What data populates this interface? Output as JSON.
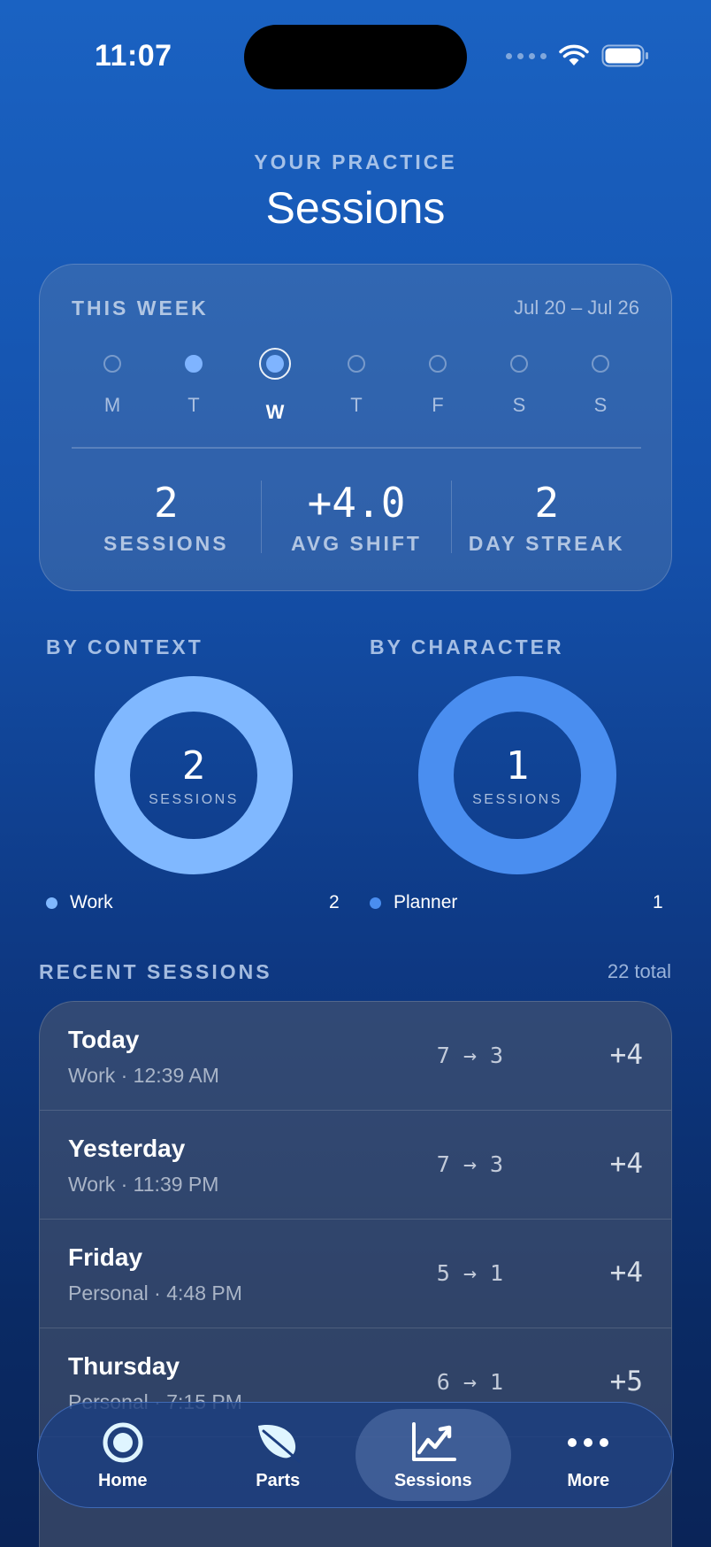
{
  "status_bar": {
    "time": "11:07"
  },
  "header": {
    "eyebrow": "YOUR PRACTICE",
    "title": "Sessions"
  },
  "week": {
    "label": "THIS WEEK",
    "range": "Jul 20 – Jul 26",
    "days": [
      "M",
      "T",
      "W",
      "T",
      "F",
      "S",
      "S"
    ],
    "stats": [
      {
        "value": "2",
        "label": "SESSIONS"
      },
      {
        "value": "+4.0",
        "label": "AVG SHIFT"
      },
      {
        "value": "2",
        "label": "DAY STREAK"
      }
    ]
  },
  "by_context": {
    "label": "BY CONTEXT",
    "value": "2",
    "unit": "SESSIONS",
    "color": "#80b8ff",
    "legend": {
      "name": "Work",
      "count": "2"
    }
  },
  "by_character": {
    "label": "BY CHARACTER",
    "value": "1",
    "unit": "SESSIONS",
    "color": "#4a8ef0",
    "legend": {
      "name": "Planner",
      "count": "1"
    }
  },
  "recent": {
    "label": "RECENT SESSIONS",
    "total": "22 total",
    "rows": [
      {
        "title": "Today",
        "sub": "Work · 12:39 AM",
        "shift": "7 → 3",
        "delta": "+4"
      },
      {
        "title": "Yesterday",
        "sub": "Work · 11:39 PM",
        "shift": "7 → 3",
        "delta": "+4"
      },
      {
        "title": "Friday",
        "sub": "Personal · 4:48 PM",
        "shift": "5 → 1",
        "delta": "+4"
      },
      {
        "title": "Thursday",
        "sub": "Personal · 7:15 PM",
        "shift": "6 → 1",
        "delta": "+5"
      }
    ]
  },
  "tabs": [
    {
      "label": "Home",
      "icon": "target-icon"
    },
    {
      "label": "Parts",
      "icon": "leaf-icon"
    },
    {
      "label": "Sessions",
      "icon": "chart-icon"
    },
    {
      "label": "More",
      "icon": "ellipsis-icon"
    }
  ]
}
